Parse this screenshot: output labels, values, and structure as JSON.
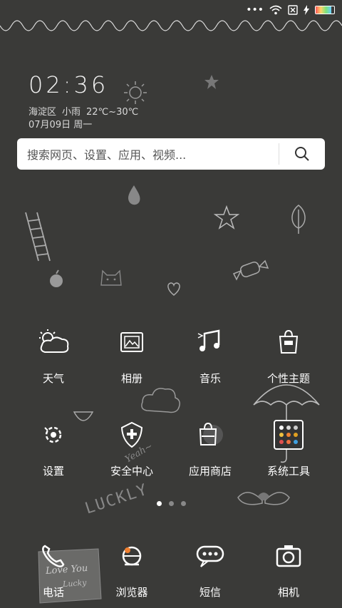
{
  "status_bar": {
    "dots": "•••",
    "icons": [
      "wifi-icon",
      "sim-icon",
      "charging-icon",
      "battery-icon"
    ],
    "battery_level": 0.85
  },
  "clock": {
    "time": "02:36",
    "district": "海淀区",
    "weather": "小雨",
    "temp": "22℃~30℃",
    "date": "07月09日 周一"
  },
  "search": {
    "placeholder": "搜索网页、设置、应用、视频..."
  },
  "apps_row1": [
    {
      "label": "天气",
      "icon": "weather-icon"
    },
    {
      "label": "相册",
      "icon": "gallery-icon"
    },
    {
      "label": "音乐",
      "icon": "music-icon"
    },
    {
      "label": "个性主题",
      "icon": "theme-icon"
    }
  ],
  "apps_row2": [
    {
      "label": "设置",
      "icon": "settings-icon"
    },
    {
      "label": "安全中心",
      "icon": "security-icon"
    },
    {
      "label": "应用商店",
      "icon": "app-store-icon"
    },
    {
      "label": "系统工具",
      "icon": "system-tools-icon"
    }
  ],
  "page_indicator": {
    "pages": 3,
    "current": 1
  },
  "dock": [
    {
      "label": "电话",
      "icon": "phone-icon"
    },
    {
      "label": "浏览器",
      "icon": "browser-icon"
    },
    {
      "label": "短信",
      "icon": "sms-icon"
    },
    {
      "label": "相机",
      "icon": "camera-icon"
    }
  ],
  "wallpaper_text": {
    "lucky": "LUCKLY",
    "yeah": "Yeah~",
    "love": "Love You",
    "lucky_small": "Lucky"
  }
}
